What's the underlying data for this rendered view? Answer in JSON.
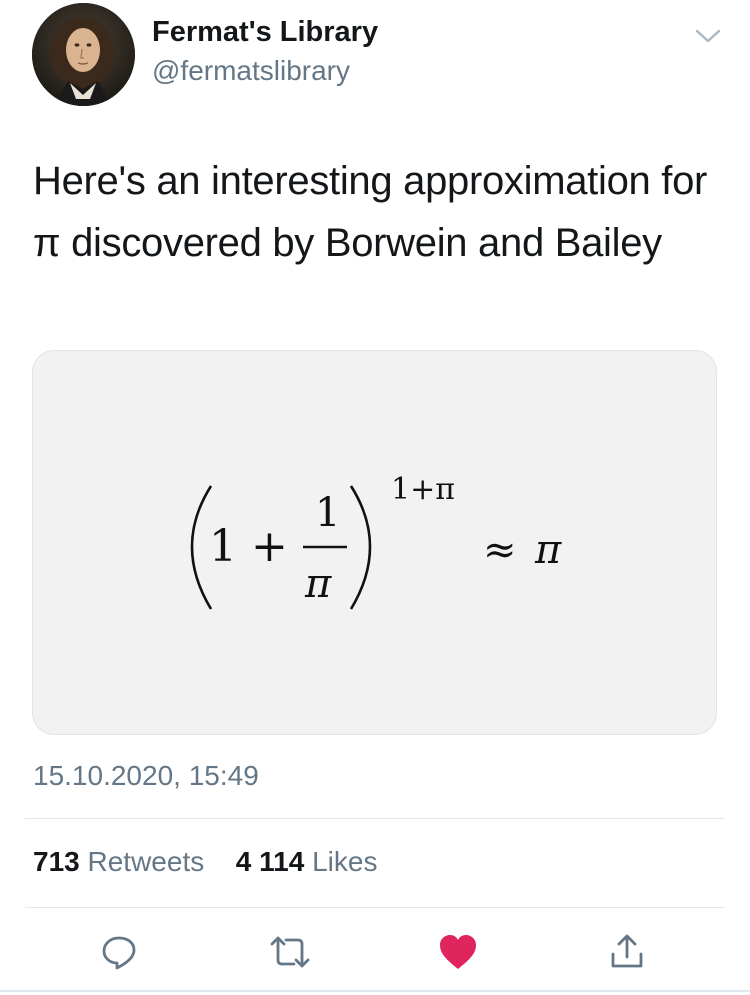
{
  "user": {
    "name": "Fermat's Library",
    "handle": "@fermatslibrary",
    "avatar_icon": "portrait-avatar"
  },
  "tweet": {
    "text": "Here's an interesting approximation for π discovered by Borwein and Bailey",
    "timestamp": "15.10.2020, 15:49"
  },
  "formula": {
    "one": "1",
    "plus": "+",
    "numerator": "1",
    "denominator": "π",
    "exponent": "1+π",
    "approx": "≈",
    "rhs": "π"
  },
  "stats": {
    "retweets_count": "713",
    "retweets_label": "Retweets",
    "likes_count": "4 114",
    "likes_label": "Likes"
  },
  "actions": {
    "reply_icon": "reply-icon",
    "retweet_icon": "retweet-icon",
    "like_icon": "heart-icon",
    "share_icon": "share-icon"
  },
  "colors": {
    "text": "#14171a",
    "muted": "#657786",
    "like": "#e0245e",
    "icon": "#657786",
    "divider": "#e1e8ed"
  }
}
